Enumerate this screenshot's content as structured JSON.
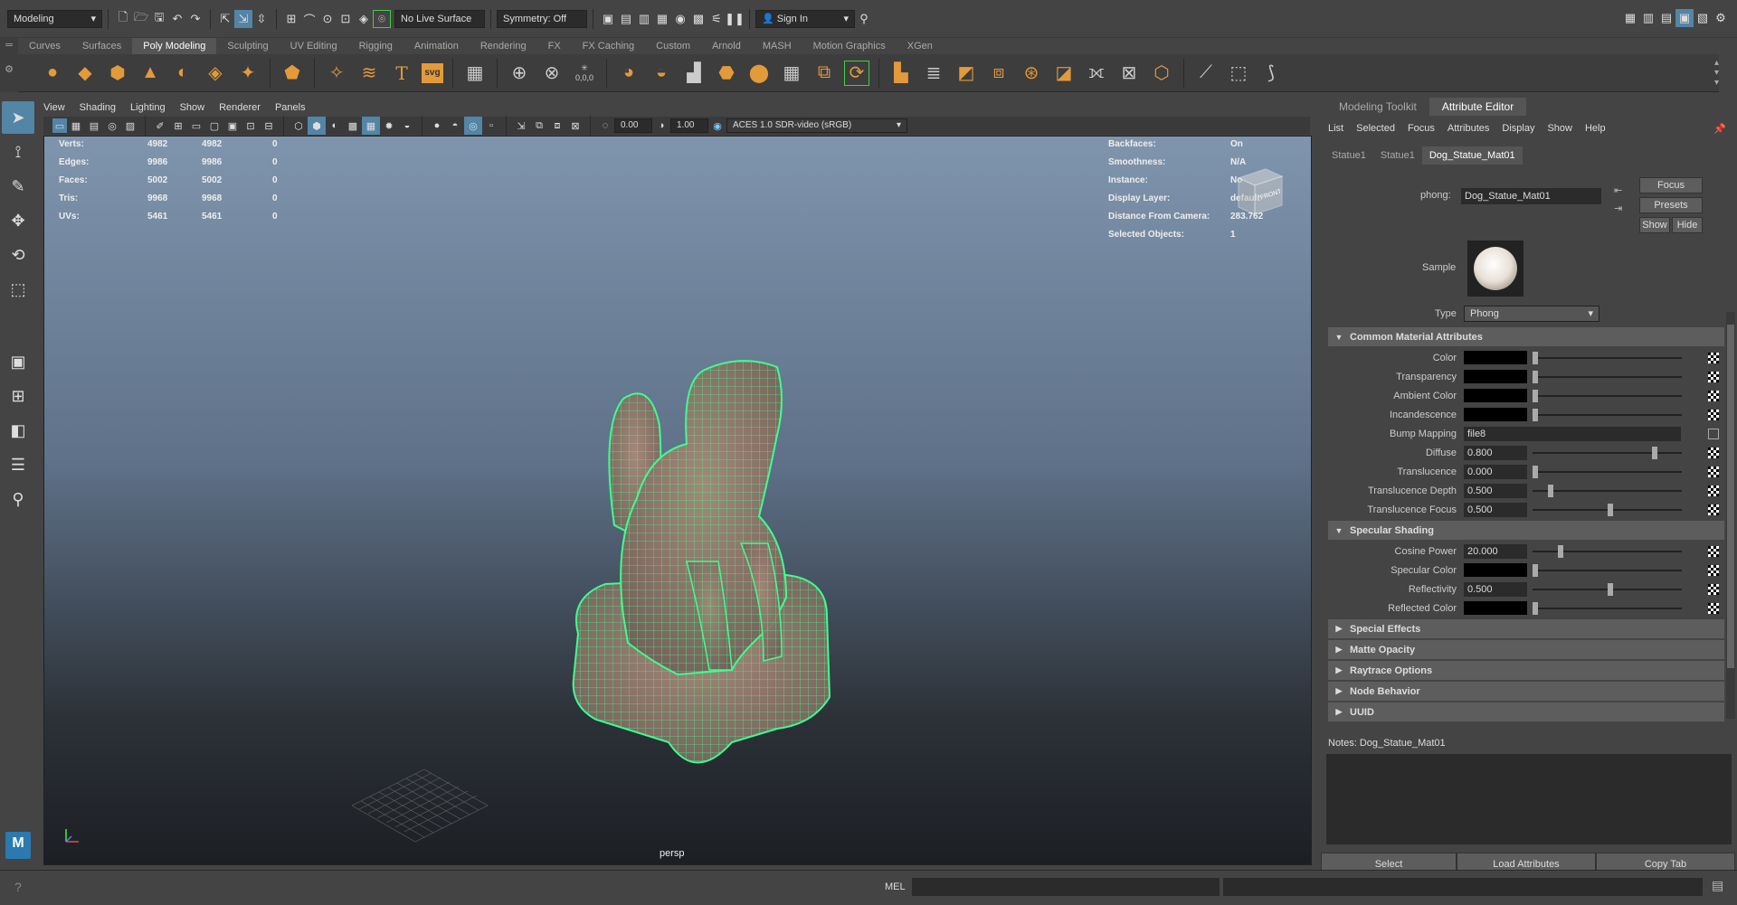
{
  "topbar": {
    "mode": "Modeling",
    "live_surface": "No Live Surface",
    "symmetry": "Symmetry: Off",
    "sign_in": "Sign In"
  },
  "shelf_tabs": [
    "Curves",
    "Surfaces",
    "Poly Modeling",
    "Sculpting",
    "UV Editing",
    "Rigging",
    "Animation",
    "Rendering",
    "FX",
    "FX Caching",
    "Custom",
    "Arnold",
    "MASH",
    "Motion Graphics",
    "XGen"
  ],
  "shelf_active": "Poly Modeling",
  "shelf_text_icons": {
    "text": "T",
    "svg": "svg",
    "coords": "0,0,0"
  },
  "viewport": {
    "menu": [
      "View",
      "Shading",
      "Lighting",
      "Show",
      "Renderer",
      "Panels"
    ],
    "exposure": "0.00",
    "gamma": "1.00",
    "colorspace": "ACES 1.0 SDR-video (sRGB)",
    "camera_label": "persp",
    "hud_left": [
      {
        "label": "Verts:",
        "a": "4982",
        "b": "4982",
        "c": "0"
      },
      {
        "label": "Edges:",
        "a": "9986",
        "b": "9986",
        "c": "0"
      },
      {
        "label": "Faces:",
        "a": "5002",
        "b": "5002",
        "c": "0"
      },
      {
        "label": "Tris:",
        "a": "9968",
        "b": "9968",
        "c": "0"
      },
      {
        "label": "UVs:",
        "a": "5461",
        "b": "5461",
        "c": "0"
      }
    ],
    "hud_right": [
      {
        "label": "Backfaces:",
        "value": "On"
      },
      {
        "label": "Smoothness:",
        "value": "N/A"
      },
      {
        "label": "Instance:",
        "value": "No"
      },
      {
        "label": "Display Layer:",
        "value": "default"
      },
      {
        "label": "Distance From Camera:",
        "value": "283.762"
      },
      {
        "label": "Selected Objects:",
        "value": "1"
      }
    ],
    "viewcube_label": "FRONT"
  },
  "right_panel": {
    "tabs": [
      "Modeling Toolkit",
      "Attribute Editor"
    ],
    "active_tab": "Attribute Editor",
    "menu": [
      "List",
      "Selected",
      "Focus",
      "Attributes",
      "Display",
      "Show",
      "Help"
    ],
    "node_tabs": [
      "Statue1",
      "Statue1",
      "Dog_Statue_Mat01"
    ],
    "phong_label": "phong:",
    "phong_value": "Dog_Statue_Mat01",
    "buttons": {
      "focus": "Focus",
      "presets": "Presets",
      "show": "Show",
      "hide": "Hide"
    },
    "sample_label": "Sample",
    "type_label": "Type",
    "type_value": "Phong",
    "common_section": "Common Material Attributes",
    "common_attrs": [
      {
        "label": "Color",
        "kind": "swatch",
        "pos": 0
      },
      {
        "label": "Transparency",
        "kind": "swatch",
        "pos": 0
      },
      {
        "label": "Ambient Color",
        "kind": "swatch",
        "pos": 0
      },
      {
        "label": "Incandescence",
        "kind": "swatch",
        "pos": 0
      },
      {
        "label": "Bump Mapping",
        "kind": "text",
        "value": "file8"
      },
      {
        "label": "Diffuse",
        "kind": "value",
        "value": "0.800",
        "pos": 0.8
      },
      {
        "label": "Translucence",
        "kind": "value",
        "value": "0.000",
        "pos": 0
      },
      {
        "label": "Translucence Depth",
        "kind": "value",
        "value": "0.500",
        "pos": 0.1
      },
      {
        "label": "Translucence Focus",
        "kind": "value",
        "value": "0.500",
        "pos": 0.5
      }
    ],
    "specular_section": "Specular Shading",
    "specular_attrs": [
      {
        "label": "Cosine Power",
        "kind": "value",
        "value": "20.000",
        "pos": 0.17
      },
      {
        "label": "Specular Color",
        "kind": "swatch",
        "pos": 0
      },
      {
        "label": "Reflectivity",
        "kind": "value",
        "value": "0.500",
        "pos": 0.5
      },
      {
        "label": "Reflected Color",
        "kind": "swatch",
        "pos": 0
      }
    ],
    "collapsed_sections": [
      "Special Effects",
      "Matte Opacity",
      "Raytrace Options",
      "Node Behavior",
      "UUID"
    ],
    "notes_label": "Notes:",
    "notes_value": "Dog_Statue_Mat01",
    "bottom_buttons": [
      "Select",
      "Load Attributes",
      "Copy Tab"
    ]
  },
  "statusbar": {
    "mel_label": "MEL"
  },
  "colors": {
    "accent": "#5285a6",
    "shelf_orange": "#e39a3b",
    "wire_green": "#33ff88"
  }
}
